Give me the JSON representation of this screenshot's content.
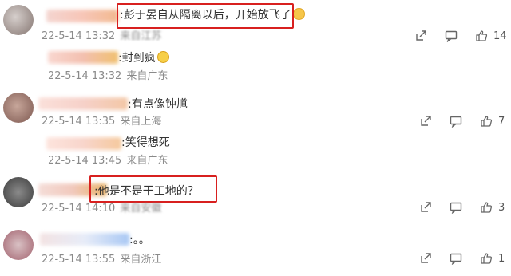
{
  "comments": [
    {
      "text": ":彭于晏自从隔离以后，开始放飞了",
      "emoji": "cat-emoji",
      "time": "22-5-14 13:32",
      "location": "来自江苏",
      "likes": "14",
      "highlighted": true
    },
    {
      "text": ":封到疯",
      "emoji": "laughing-emoji",
      "time": "22-5-14 13:32",
      "location": "来自广东",
      "reply": true
    },
    {
      "text": ":有点像钟馗",
      "time": "22-5-14 13:35",
      "location": "来自上海",
      "likes": "7"
    },
    {
      "text": ":笑得想死",
      "time": "22-5-14 13:45",
      "location": "来自广东",
      "reply": true
    },
    {
      "text": ":他是不是干工地的？",
      "time": "22-5-14 14:10",
      "location": "来自安徽",
      "likes": "3",
      "highlighted": true
    },
    {
      "text": ":。。",
      "time": "22-5-14 13:55",
      "location": "来自浙江",
      "likes": "1"
    }
  ],
  "icons": {
    "share": "share-icon",
    "comment": "comment-icon",
    "like": "thumbs-up-icon"
  },
  "colors": {
    "highlight": "#d8201f",
    "meta_text": "#8a8a8a"
  }
}
